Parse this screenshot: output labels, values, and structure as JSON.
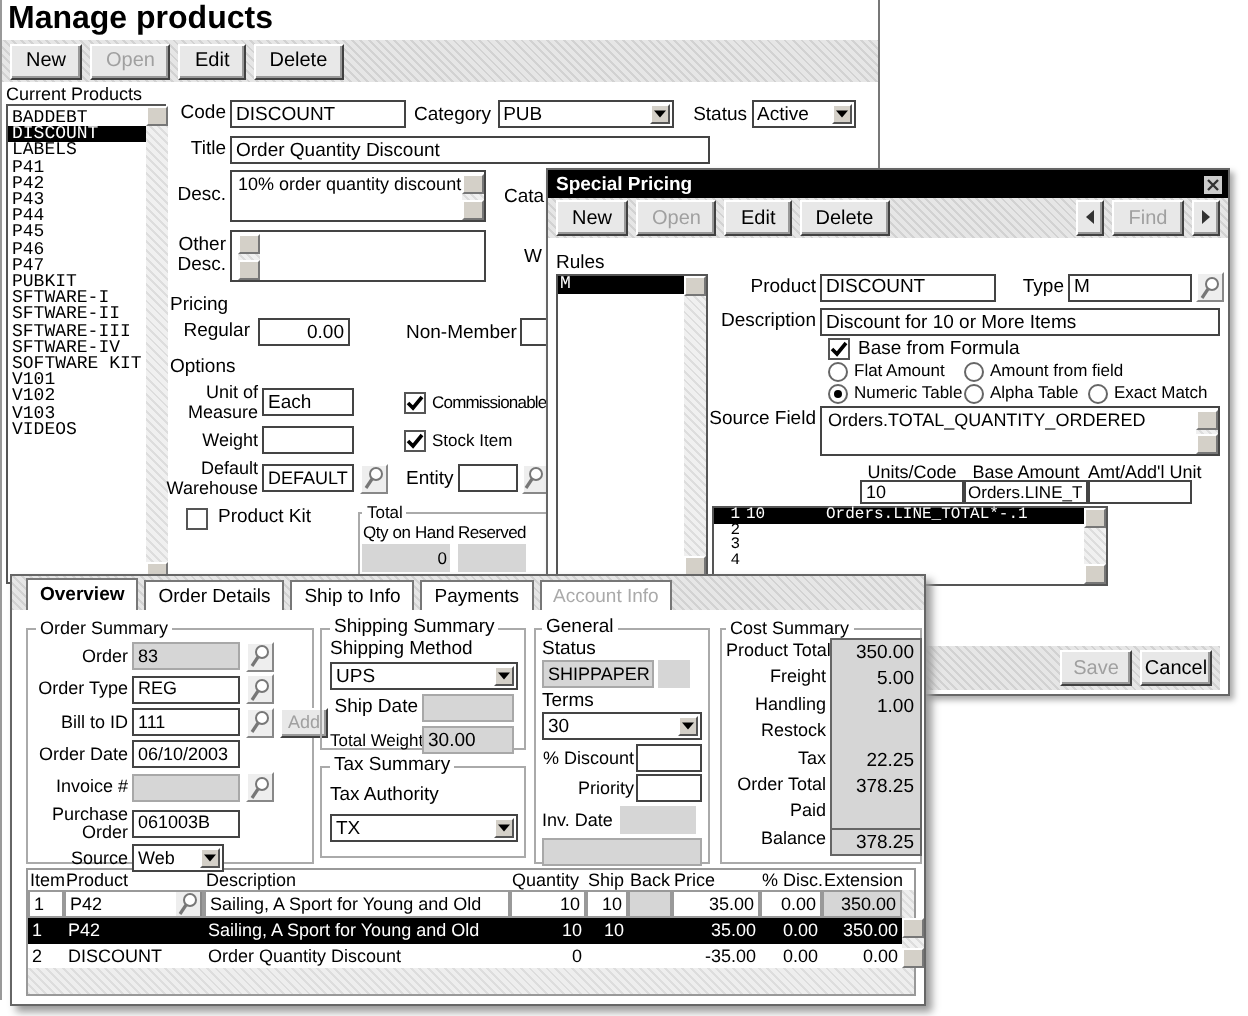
{
  "main_window": {
    "title": "Manage products",
    "toolbar": [
      {
        "label": "New",
        "disabled": false
      },
      {
        "label": "Open",
        "disabled": true
      },
      {
        "label": "Edit",
        "disabled": false
      },
      {
        "label": "Delete",
        "disabled": false
      }
    ],
    "products_label": "Current Products",
    "products": [
      {
        "name": "BADDEBT",
        "selected": false
      },
      {
        "name": "DISCOUNT",
        "selected": true
      },
      {
        "name": "LABELS",
        "selected": false
      },
      {
        "name": "P41",
        "selected": false
      },
      {
        "name": "P42",
        "selected": false
      },
      {
        "name": "P43",
        "selected": false
      },
      {
        "name": "P44",
        "selected": false
      },
      {
        "name": "P45",
        "selected": false
      },
      {
        "name": "P46",
        "selected": false
      },
      {
        "name": "P47",
        "selected": false
      },
      {
        "name": "PUBKIT",
        "selected": false
      },
      {
        "name": "SFTWARE-I",
        "selected": false
      },
      {
        "name": "SFTWARE-II",
        "selected": false
      },
      {
        "name": "SFTWARE-III",
        "selected": false
      },
      {
        "name": "SFTWARE-IV",
        "selected": false
      },
      {
        "name": "SOFTWARE KIT",
        "selected": false
      },
      {
        "name": "V101",
        "selected": false
      },
      {
        "name": "V102",
        "selected": false
      },
      {
        "name": "V103",
        "selected": false
      },
      {
        "name": "VIDEOS",
        "selected": false
      }
    ],
    "form": {
      "code": {
        "label": "Code",
        "value": "DISCOUNT"
      },
      "category": {
        "label": "Category",
        "value": "PUB"
      },
      "status": {
        "label": "Status",
        "value": "Active"
      },
      "title": {
        "label": "Title",
        "value": "Order Quantity Discount"
      },
      "desc": {
        "label": "Desc.",
        "value": "10% order quantity discount"
      },
      "catalog_cut": "Cata",
      "other_desc": {
        "label": "Other Desc."
      },
      "weight_cut": "W",
      "pricing_heading": "Pricing",
      "regular": {
        "label": "Regular",
        "value": "0.00"
      },
      "non_member": {
        "label": "Non-Member"
      },
      "options_heading": "Options",
      "unit": {
        "label": "Unit of Measure",
        "value": "Each"
      },
      "weight": {
        "label": "Weight"
      },
      "warehouse": {
        "label": "Default Warehouse",
        "value": "DEFAULT"
      },
      "commissionable": {
        "label": "Commissionable",
        "checked": true
      },
      "stock_item": {
        "label": "Stock Item",
        "checked": true
      },
      "entity": {
        "label": "Entity"
      },
      "product_kit": {
        "label": "Product Kit",
        "checked": false
      },
      "total": {
        "title": "Total",
        "qty_label": "Qty on Hand",
        "qty_value": "0",
        "reserved_label": "Reserved"
      }
    }
  },
  "special_pricing": {
    "title": "Special Pricing",
    "toolbar": [
      {
        "label": "New",
        "disabled": false
      },
      {
        "label": "Open",
        "disabled": true
      },
      {
        "label": "Edit",
        "disabled": false
      },
      {
        "label": "Delete",
        "disabled": false
      }
    ],
    "find": {
      "label": "Find",
      "disabled": true
    },
    "rules_label": "Rules",
    "rules": [
      {
        "name": "M",
        "selected": true
      }
    ],
    "product": {
      "label": "Product",
      "value": "DISCOUNT"
    },
    "type": {
      "label": "Type",
      "value": "M"
    },
    "description": {
      "label": "Description",
      "value": "Discount for 10 or More Items"
    },
    "base_from_formula": {
      "label": "Base from Formula",
      "checked": true
    },
    "modes": [
      {
        "label": "Flat Amount",
        "selected": false
      },
      {
        "label": "Amount from field",
        "selected": false
      },
      {
        "label": "Numeric Table",
        "selected": true
      },
      {
        "label": "Alpha Table",
        "selected": false
      },
      {
        "label": "Exact Match",
        "selected": false
      }
    ],
    "source_field": {
      "label": "Source Field",
      "value": "Orders.TOTAL_QUANTITY_ORDERED"
    },
    "table": {
      "columns": [
        "Units/Code",
        "Base Amount",
        "Amt/Add'l Unit"
      ],
      "entry": {
        "units": "10",
        "amount": "Orders.LINE_T"
      },
      "rows": [
        {
          "number": "1",
          "units": "10",
          "amount": "Orders.LINE_TOTAL*-.1",
          "selected": true
        },
        {
          "number": "2",
          "selected": false
        },
        {
          "number": "3",
          "selected": false
        },
        {
          "number": "4",
          "selected": false
        }
      ]
    },
    "buttons": [
      {
        "label": "Save",
        "disabled": true
      },
      {
        "label": "Cancel",
        "disabled": false
      }
    ]
  },
  "order_window": {
    "tabs": [
      {
        "label": "Overview",
        "selected": true,
        "disabled": false
      },
      {
        "label": "Order Details",
        "selected": false,
        "disabled": false
      },
      {
        "label": "Ship to Info",
        "selected": false,
        "disabled": false
      },
      {
        "label": "Payments",
        "selected": false,
        "disabled": false
      },
      {
        "label": "Account Info",
        "selected": false,
        "disabled": true
      }
    ],
    "order_summary": {
      "title": "Order Summary",
      "fields": [
        {
          "label": "Order",
          "value": "83",
          "kind": "text",
          "readonly": true,
          "lookup": true
        },
        {
          "label": "Order Type",
          "value": "REG",
          "kind": "text",
          "readonly": false,
          "lookup": true
        },
        {
          "label": "Bill to ID",
          "value": "111",
          "kind": "text",
          "readonly": false,
          "lookup": true,
          "button": {
            "label": "Add",
            "disabled": true
          }
        },
        {
          "label": "Order Date",
          "value": "06/10/2003",
          "kind": "text",
          "readonly": false,
          "lookup": false
        },
        {
          "label": "Invoice #",
          "kind": "text",
          "readonly": true,
          "lookup": true
        },
        {
          "label": "Purchase Order",
          "value": "061003B",
          "kind": "text",
          "readonly": false,
          "lookup": false
        },
        {
          "label": "Source",
          "value": "Web",
          "kind": "dropdown",
          "readonly": false,
          "lookup": false
        }
      ]
    },
    "shipping_summary": {
      "title": "Shipping Summary",
      "method_label": "Shipping Method",
      "method": "UPS",
      "ship_date_label": "Ship Date",
      "total_weight_label": "Total Weight",
      "total_weight": "30.00"
    },
    "tax_summary": {
      "title": "Tax Summary",
      "authority_label": "Tax Authority",
      "authority": "TX"
    },
    "general": {
      "title": "General",
      "status_label": "Status",
      "status": "SHIPPAPER",
      "terms_label": "Terms",
      "terms": "30",
      "discount_label": "% Discount",
      "priority_label": "Priority",
      "inv_date_label": "Inv. Date"
    },
    "cost_summary": {
      "title": "Cost Summary",
      "rows": [
        {
          "label": "Product Total",
          "value": "350.00"
        },
        {
          "label": "Freight",
          "value": "5.00"
        },
        {
          "label": "Handling",
          "value": "1.00"
        },
        {
          "label": "Restock"
        },
        {
          "label": "Tax",
          "value": "22.25"
        },
        {
          "label": "Order Total",
          "value": "378.25"
        },
        {
          "label": "Paid"
        },
        {
          "label": "Balance",
          "value": "378.25"
        }
      ]
    },
    "items": {
      "columns": [
        "Item",
        "Product",
        "Description",
        "Quantity",
        "Ship",
        "Back",
        "Price",
        "% Disc.",
        "Extension"
      ],
      "entry": {
        "item": "1",
        "product": "P42",
        "description": "Sailing, A Sport for Young and Old",
        "quantity": "10",
        "ship": "10",
        "price": "35.00",
        "discount": "0.00",
        "extension": "350.00"
      },
      "rows": [
        {
          "item": "1",
          "product": "P42",
          "description": "Sailing, A Sport for Young and Old",
          "quantity": "10",
          "ship": "10",
          "price": "35.00",
          "discount": "0.00",
          "extension": "350.00",
          "selected": true
        },
        {
          "item": "2",
          "product": "DISCOUNT",
          "description": "Order Quantity Discount",
          "quantity": "0",
          "price": "-35.00",
          "discount": "0.00",
          "extension": "0.00",
          "selected": false
        }
      ]
    }
  }
}
